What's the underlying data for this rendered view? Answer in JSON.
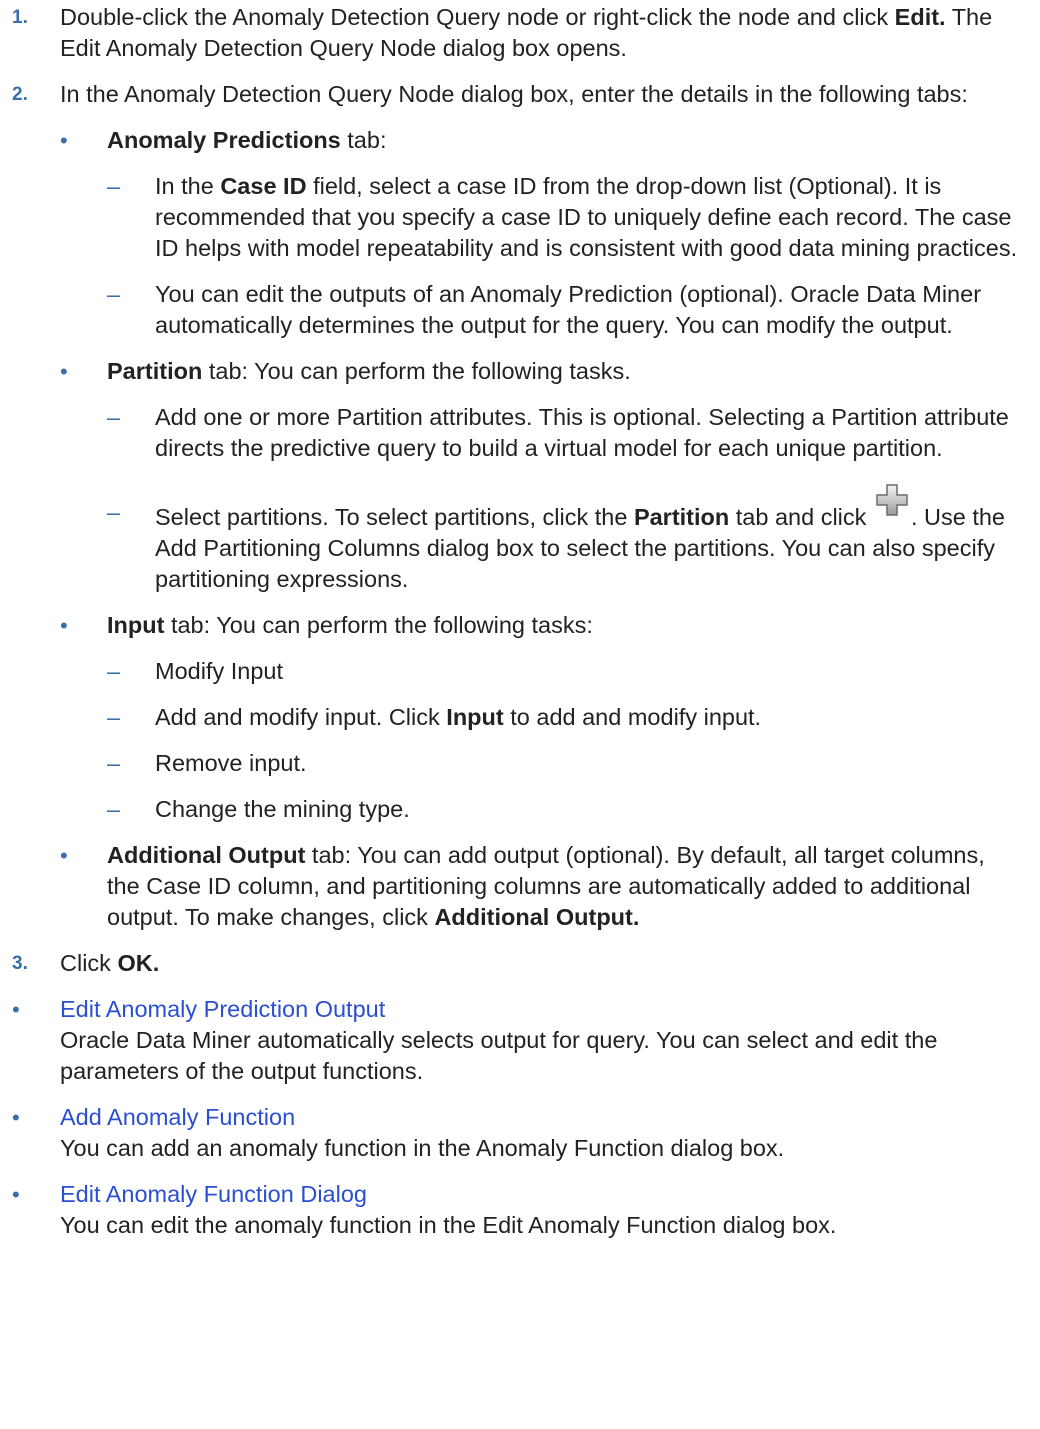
{
  "step1": {
    "num": "1.",
    "pre": "Double-click the Anomaly Detection Query node or right-click the node and click ",
    "bold": "Edit.",
    "post": " The Edit Anomaly Detection Query Node dialog box opens."
  },
  "step2": {
    "num": "2.",
    "text": "In the Anomaly Detection Query Node dialog box, enter the details in the following tabs:",
    "tabs": {
      "anomaly": {
        "bold": "Anomaly Predictions",
        "post": " tab:",
        "sub1": {
          "pre": "In the ",
          "bold": "Case ID",
          "post": " field, select a case ID from the drop-down list (Optional). It is recommended that you specify a case ID to uniquely define each re­cord. The case ID helps with model repeatability and is consistent with good data mining practices."
        },
        "sub2": "You can edit the outputs of an Anomaly Prediction (optional). Oracle Data Miner automatically determines the output for the query. You can modify the output."
      },
      "partition": {
        "bold": "Partition",
        "post": " tab: You can perform the following tasks.",
        "sub1": "Add one or more Partition attributes. This is optional. Selecting a Partition attribute directs the predictive query to build a virtual model for each unique partition.",
        "sub2": {
          "pre": "Select partitions. To select partitions, click the ",
          "bold": "Partition",
          "mid": " tab and click ",
          "post": ". Use the Add Partitioning Columns dialog box to select the partitions. You can also specify partitioning expressions."
        }
      },
      "input": {
        "bold": "Input",
        "post": " tab: You can perform the following tasks:",
        "sub1": "Modify Input",
        "sub2": {
          "pre": "Add and modify input. Click ",
          "bold": "Input",
          "post": " to add and modify input."
        },
        "sub3": "Remove input.",
        "sub4": "Change the mining type."
      },
      "additional": {
        "bold": "Additional Output",
        "post": " tab: You can add output (optional). By default, all target columns, the Case ID column, and partitioning columns are automatically add­ed to additional output. To make changes, click ",
        "bold2": "Additional Output."
      }
    }
  },
  "step3": {
    "num": "3.",
    "pre": "Click ",
    "bold": "OK."
  },
  "bullet_char": "•",
  "dash_char": "–",
  "links": [
    {
      "label": "Edit Anomaly Prediction Output",
      "desc": "Oracle Data Miner automatically selects output for query. You can select and edit the parameters of the output functions."
    },
    {
      "label": "Add Anomaly Function",
      "desc": "You can add an anomaly function in the Anomaly Function dialog box."
    },
    {
      "label": "Edit Anomaly Function Dialog",
      "desc": "You can edit the anomaly function in the Edit Anomaly Function dialog box."
    }
  ],
  "icons": {
    "add": "plus-icon"
  },
  "colors": {
    "accent": "#3a6ea8",
    "link": "#2a4fd0",
    "text": "#222222"
  }
}
